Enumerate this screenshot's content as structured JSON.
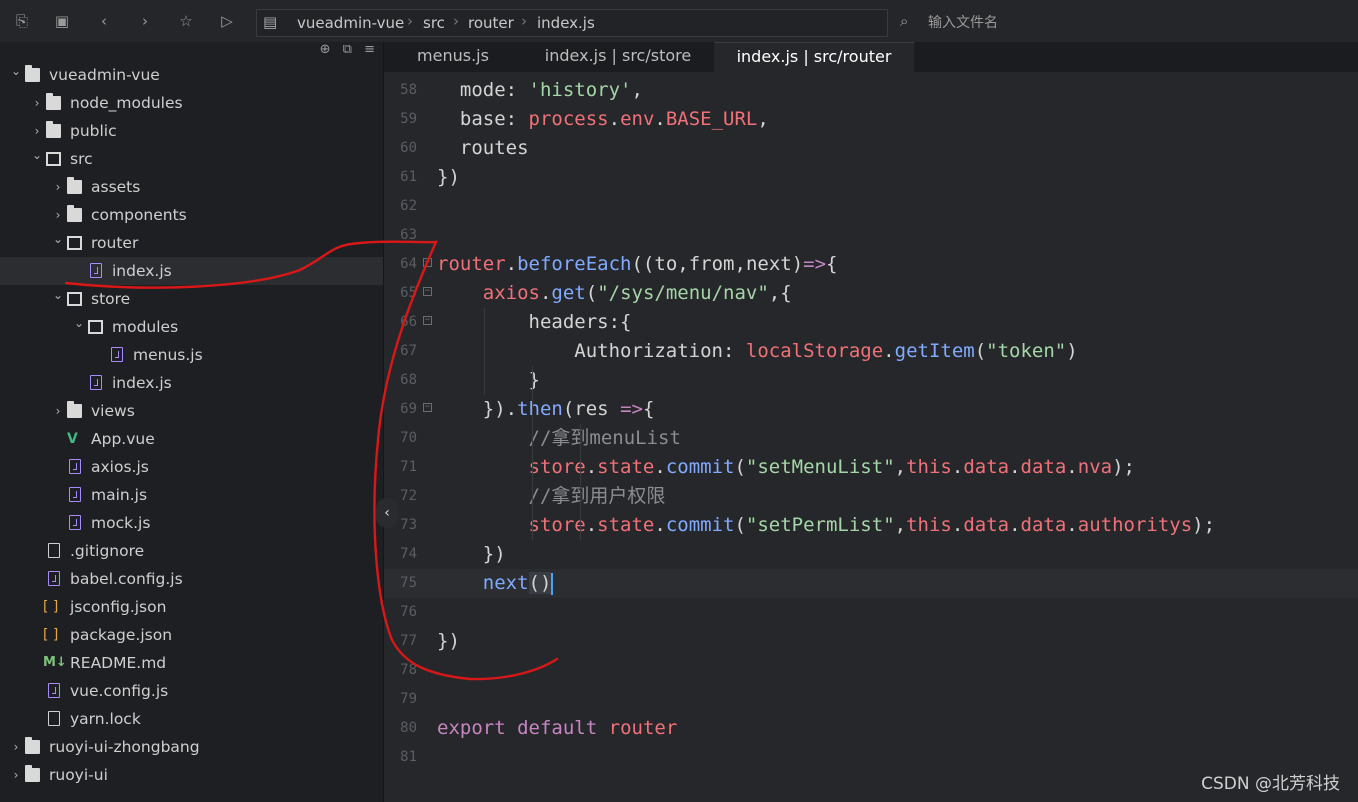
{
  "toolbar": {
    "buttons": [
      "outline-icon",
      "save-icon",
      "back-icon",
      "forward-icon",
      "star-icon",
      "run-icon"
    ],
    "breadcrumb": [
      "vueadmin-vue",
      "src",
      "router",
      "index.js"
    ],
    "search_placeholder": "输入文件名"
  },
  "sidebar": {
    "tree": [
      {
        "label": "vueadmin-vue",
        "type": "root",
        "depth": 0,
        "arrow": "expanded"
      },
      {
        "label": "node_modules",
        "type": "folder",
        "depth": 1,
        "arrow": "collapsed"
      },
      {
        "label": "public",
        "type": "folder",
        "depth": 1,
        "arrow": "collapsed"
      },
      {
        "label": "src",
        "type": "folder-open",
        "depth": 1,
        "arrow": "expanded"
      },
      {
        "label": "assets",
        "type": "folder",
        "depth": 2,
        "arrow": "collapsed"
      },
      {
        "label": "components",
        "type": "folder",
        "depth": 2,
        "arrow": "collapsed"
      },
      {
        "label": "router",
        "type": "folder-open",
        "depth": 2,
        "arrow": "expanded"
      },
      {
        "label": "index.js",
        "type": "js",
        "depth": 3,
        "selected": true
      },
      {
        "label": "store",
        "type": "folder-open",
        "depth": 2,
        "arrow": "expanded"
      },
      {
        "label": "modules",
        "type": "folder-open",
        "depth": 3,
        "arrow": "expanded"
      },
      {
        "label": "menus.js",
        "type": "js",
        "depth": 4
      },
      {
        "label": "index.js",
        "type": "js",
        "depth": 3
      },
      {
        "label": "views",
        "type": "folder",
        "depth": 2,
        "arrow": "collapsed"
      },
      {
        "label": "App.vue",
        "type": "vue",
        "depth": 2
      },
      {
        "label": "axios.js",
        "type": "js",
        "depth": 2
      },
      {
        "label": "main.js",
        "type": "js",
        "depth": 2
      },
      {
        "label": "mock.js",
        "type": "js",
        "depth": 2
      },
      {
        "label": ".gitignore",
        "type": "plain",
        "depth": 1
      },
      {
        "label": "babel.config.js",
        "type": "js",
        "depth": 1
      },
      {
        "label": "jsconfig.json",
        "type": "json",
        "depth": 1
      },
      {
        "label": "package.json",
        "type": "json",
        "depth": 1
      },
      {
        "label": "README.md",
        "type": "md",
        "depth": 1
      },
      {
        "label": "vue.config.js",
        "type": "js",
        "depth": 1
      },
      {
        "label": "yarn.lock",
        "type": "plain",
        "depth": 1
      },
      {
        "label": "ruoyi-ui-zhongbang",
        "type": "root",
        "depth": 0,
        "arrow": "collapsed"
      },
      {
        "label": "ruoyi-ui",
        "type": "root",
        "depth": 0,
        "arrow": "collapsed"
      }
    ]
  },
  "tabs": [
    {
      "label": "menus.js",
      "active": false
    },
    {
      "label": "index.js | src/store",
      "active": false
    },
    {
      "label": "index.js | src/router",
      "active": true
    }
  ],
  "editor": {
    "lines": [
      {
        "n": "58",
        "code": "  mode: 'history',"
      },
      {
        "n": "59",
        "code": "  base: process.env.BASE_URL,"
      },
      {
        "n": "60",
        "code": "  routes"
      },
      {
        "n": "61",
        "code": "})"
      },
      {
        "n": "62",
        "code": ""
      },
      {
        "n": "63",
        "code": ""
      },
      {
        "n": "64",
        "code": "router.beforeEach((to,from,next)=>{"
      },
      {
        "n": "65",
        "code": "    axios.get(\"/sys/menu/nav\",{"
      },
      {
        "n": "66",
        "code": "        headers:{"
      },
      {
        "n": "67",
        "code": "            Authorization: localStorage.getItem(\"token\")"
      },
      {
        "n": "68",
        "code": "        }"
      },
      {
        "n": "69",
        "code": "    }).then(res =>{"
      },
      {
        "n": "70",
        "code": "        //拿到menuList"
      },
      {
        "n": "71",
        "code": "        store.state.commit(\"setMenuList\",this.data.data.nva);"
      },
      {
        "n": "72",
        "code": "        //拿到用户权限"
      },
      {
        "n": "73",
        "code": "        store.state.commit(\"setPermList\",this.data.data.authoritys);"
      },
      {
        "n": "74",
        "code": "    })"
      },
      {
        "n": "75",
        "code": "    next()"
      },
      {
        "n": "76",
        "code": ""
      },
      {
        "n": "77",
        "code": "})"
      },
      {
        "n": "78",
        "code": ""
      },
      {
        "n": "79",
        "code": ""
      },
      {
        "n": "80",
        "code": "export default router"
      },
      {
        "n": "81",
        "code": ""
      }
    ],
    "current_line": "75"
  },
  "watermark": "CSDN @北芳科技",
  "colors": {
    "annotation": "#e01010",
    "keyword": "#c586c0",
    "string": "#a5d6a7",
    "variable": "#f07178",
    "function": "#82aaff"
  }
}
